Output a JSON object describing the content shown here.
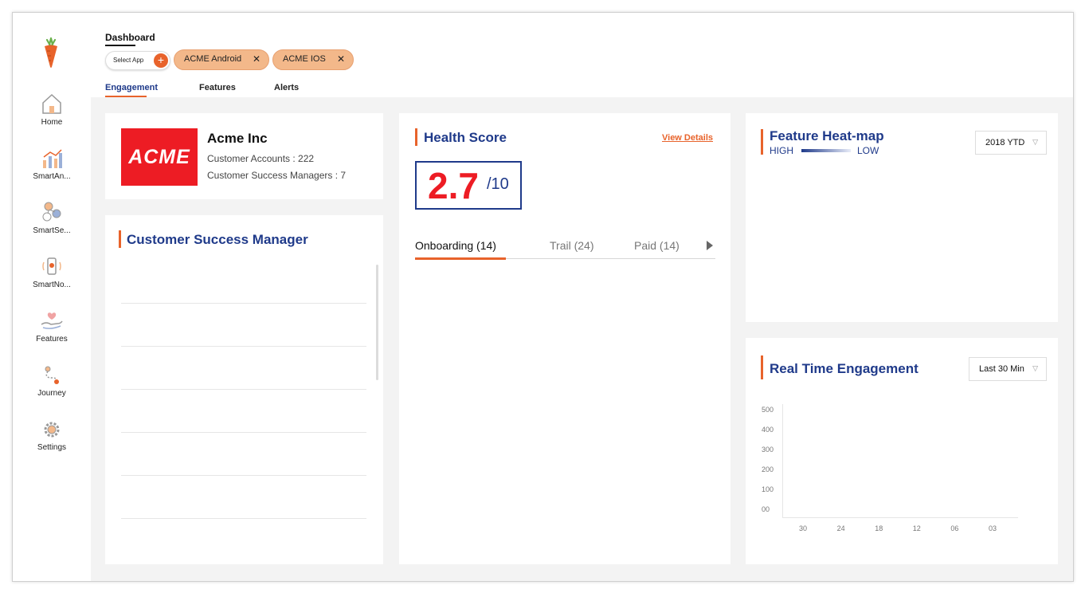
{
  "colors": {
    "accent": "#e8632b",
    "primary": "#1f3a8a",
    "score": "#ed1c24"
  },
  "sidebar": {
    "items": [
      {
        "label": "Home",
        "icon": "home-icon"
      },
      {
        "label": "SmartAn...",
        "icon": "analytics-icon"
      },
      {
        "label": "SmartSe...",
        "icon": "segments-icon"
      },
      {
        "label": "SmartNo...",
        "icon": "notifications-icon"
      },
      {
        "label": "Features",
        "icon": "features-icon"
      },
      {
        "label": "Journey",
        "icon": "journey-icon"
      },
      {
        "label": "Settings",
        "icon": "settings-icon"
      }
    ]
  },
  "header": {
    "title": "Dashboard",
    "select_app": "Select App",
    "chips": [
      {
        "label": "ACME Android"
      },
      {
        "label": "ACME IOS"
      }
    ],
    "tabs": [
      {
        "label": "Engagement"
      },
      {
        "label": "Features"
      },
      {
        "label": "Alerts"
      }
    ]
  },
  "company": {
    "logo_text": "ACME",
    "name": "Acme Inc",
    "accounts": "Customer Accounts : 222",
    "managers": "Customer Success Managers : 7"
  },
  "csm": {
    "title": "Customer Success Manager"
  },
  "health": {
    "title": "Health Score",
    "view_details": "View Details",
    "score": "2.7",
    "max": "/10",
    "tabs": [
      {
        "label": "Onboarding (14)"
      },
      {
        "label": "Trail (24)"
      },
      {
        "label": "Paid (14)"
      }
    ]
  },
  "heatmap": {
    "title": "Feature Heat-map",
    "legend_high": "HIGH",
    "legend_low": "LOW",
    "period": "2018 YTD"
  },
  "realtime": {
    "title": "Real Time Engagement",
    "range": "Last 30 Min"
  },
  "chart_data": {
    "type": "line",
    "categories": [
      "30",
      "24",
      "18",
      "12",
      "06",
      "03"
    ],
    "y_ticks": [
      "500",
      "400",
      "300",
      "200",
      "100",
      "00"
    ],
    "series": [],
    "ylim": [
      0,
      500
    ]
  }
}
